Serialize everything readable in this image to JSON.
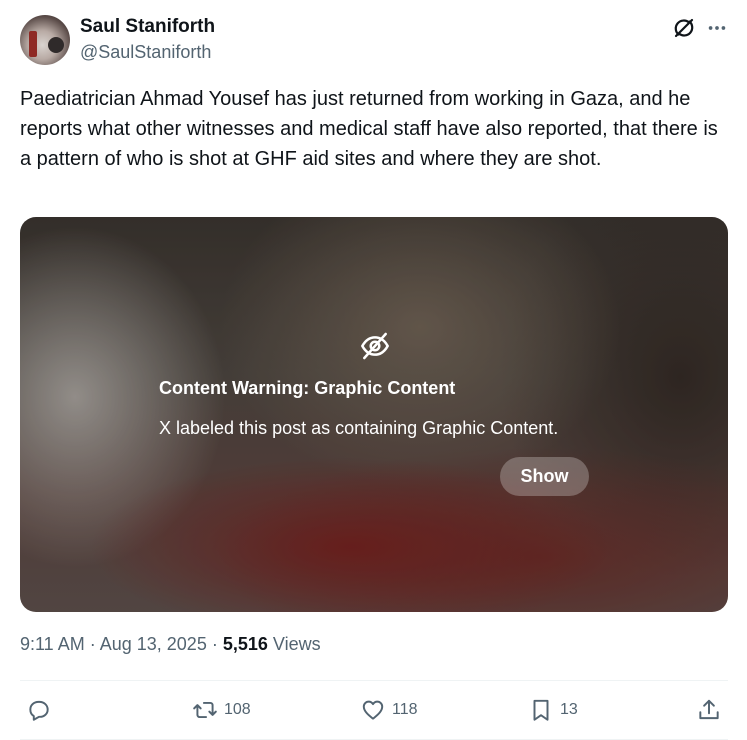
{
  "author": {
    "name": "Saul Staniforth",
    "handle": "@SaulStaniforth"
  },
  "header_icons": [
    "grok-icon",
    "more-icon"
  ],
  "tweet": {
    "text": "Paediatrician Ahmad Yousef has just returned from working in Gaza, and he reports what other witnesses and medical staff have also reported, that there is a pattern of who is shot at GHF aid sites and where they are shot."
  },
  "media_warning": {
    "icon": "eye-slash-icon",
    "title": "Content Warning: Graphic Content",
    "body": "X labeled this post as containing Graphic Content.",
    "show_label": "Show"
  },
  "meta": {
    "time": "9:11 AM",
    "separator1": " · ",
    "date": "Aug 13, 2025",
    "separator2": " · ",
    "views_count": "5,516",
    "views_label": " Views"
  },
  "actions": {
    "replies": "",
    "reposts": "108",
    "likes": "118",
    "bookmarks": "13"
  },
  "colors": {
    "text": "#0f1419",
    "secondary": "#536471",
    "divider": "#eff3f4"
  }
}
